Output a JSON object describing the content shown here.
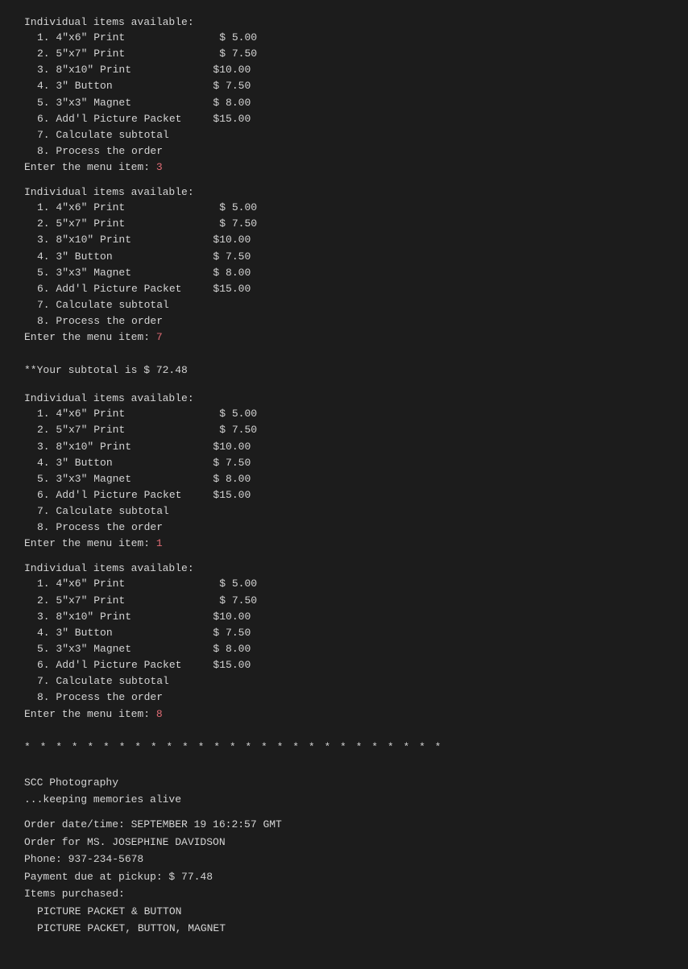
{
  "terminal": {
    "background": "#1c1c1c",
    "text_color": "#d4d4d4",
    "input_color": "#e06c75"
  },
  "menu": {
    "header": "Individual items available:",
    "items": [
      {
        "num": "1.",
        "name": "4\"x6\" Print",
        "price": "$  5.00"
      },
      {
        "num": "2.",
        "name": "5\"x7\" Print",
        "price": "$  7.50"
      },
      {
        "num": "3.",
        "name": "8\"x10\" Print",
        "price": "$10.00"
      },
      {
        "num": "4.",
        "name": "3\" Button",
        "price": "$  7.50"
      },
      {
        "num": "5.",
        "name": "3\"x3\" Magnet",
        "price": "$  8.00"
      },
      {
        "num": "6.",
        "name": "Add'l Picture Packet",
        "price": "$15.00"
      },
      {
        "num": "7.",
        "name": "Calculate subtotal",
        "price": ""
      },
      {
        "num": "8.",
        "name": "Process the order",
        "price": ""
      }
    ]
  },
  "sessions": [
    {
      "prompt": "Enter the menu item: ",
      "input": "3"
    },
    {
      "prompt": "Enter the menu item: ",
      "input": "7"
    },
    {
      "prompt": "Enter the menu item: ",
      "input": "1"
    },
    {
      "prompt": "Enter the menu item: ",
      "input": "8"
    }
  ],
  "subtotal_line": "**Your subtotal is $ 72.48",
  "separator": "* * * * * * * * * * * * * * * * * * * * * * * * * * *",
  "receipt": {
    "company": "SCC Photography",
    "tagline": "   ...keeping memories alive",
    "blank_line": "",
    "order_datetime": "Order date/time: SEPTEMBER 19 16:2:57 GMT",
    "order_for": "Order for MS. JOSEPHINE DAVIDSON",
    "phone": "Phone: 937-234-5678",
    "payment": "Payment due at pickup: $ 77.48",
    "items_header": "Items purchased:",
    "items": [
      "PICTURE PACKET & BUTTON",
      "PICTURE PACKET, BUTTON, MAGNET"
    ]
  }
}
